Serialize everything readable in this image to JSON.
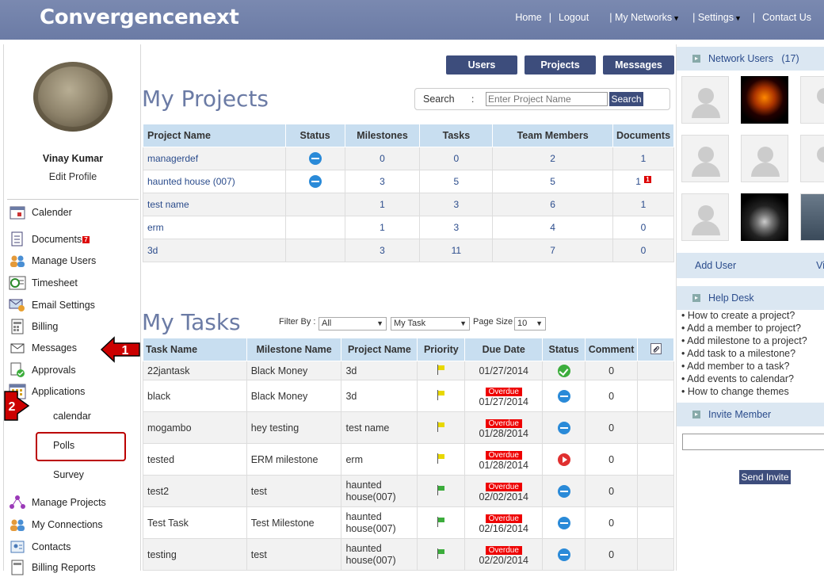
{
  "app": {
    "brand": "Convergencenext"
  },
  "topnav": {
    "home": "Home",
    "logout": "Logout",
    "my_networks": "| My Networks",
    "settings": "| Settings",
    "contact": "Contact Us",
    "sep": "|"
  },
  "profile": {
    "name": "Vinay Kumar",
    "edit": "Edit Profile"
  },
  "sidebar": {
    "calender": "Calender",
    "documents": "Documents",
    "documents_badge": "7",
    "manage_users": "Manage Users",
    "timesheet": "Timesheet",
    "email_settings": "Email Settings",
    "billing": "Billing",
    "messages": "Messages",
    "approvals": "Approvals",
    "applications": "Applications",
    "sub_calendar": "calendar",
    "sub_polls": "Polls",
    "sub_survey": "Survey",
    "manage_projects": "Manage Projects",
    "my_connections": "My Connections",
    "contacts": "Contacts",
    "billing_reports": "Billing Reports",
    "callout1": "1",
    "callout2": "2"
  },
  "tabs": {
    "users": "Users",
    "projects": "Projects",
    "messages": "Messages"
  },
  "projects": {
    "title": "My Projects",
    "search_label": "Search",
    "search_colon": ":",
    "search_placeholder": "Enter Project Name",
    "search_button": "Search",
    "columns": [
      "Project Name",
      "Status",
      "Milestones",
      "Tasks",
      "Team Members",
      "Documents"
    ],
    "rows": [
      {
        "name": "managerdef",
        "milestones": "0",
        "tasks": "0",
        "team": "2",
        "docs": "1",
        "badge": ""
      },
      {
        "name": "haunted house (007)",
        "milestones": "3",
        "tasks": "5",
        "team": "5",
        "docs": "1",
        "badge": "1"
      },
      {
        "name": "test name",
        "milestones": "1",
        "tasks": "3",
        "team": "6",
        "docs": "1",
        "badge": ""
      },
      {
        "name": "erm",
        "milestones": "1",
        "tasks": "3",
        "team": "4",
        "docs": "0",
        "badge": ""
      },
      {
        "name": "3d",
        "milestones": "3",
        "tasks": "11",
        "team": "7",
        "docs": "0",
        "badge": ""
      }
    ]
  },
  "tasks": {
    "title": "My Tasks",
    "filter_label": "Filter By :",
    "filter1": "All",
    "filter2": "My Task",
    "page_size_label": "Page Size :",
    "page_size": "10",
    "columns": [
      "Task Name",
      "Milestone Name",
      "Project Name",
      "Priority",
      "Due Date",
      "Status",
      "Comment"
    ],
    "overdue": "Overdue",
    "rows": [
      {
        "name": "22jantask",
        "milestone": "Black Money",
        "project": "3d",
        "date": "01/27/2014",
        "comment": "0"
      },
      {
        "name": "black",
        "milestone": "Black Money",
        "project": "3d",
        "date": "01/27/2014",
        "comment": "0"
      },
      {
        "name": "mogambo",
        "milestone": "hey testing",
        "project": "test name",
        "date": "01/28/2014",
        "comment": "0"
      },
      {
        "name": "tested",
        "milestone": "ERM milestone",
        "project": "erm",
        "date": "01/28/2014",
        "comment": "0"
      },
      {
        "name": "test2",
        "milestone": "test",
        "project": "haunted house(007)",
        "date": "02/02/2014",
        "comment": "0"
      },
      {
        "name": "Test Task",
        "milestone": "Test Milestone",
        "project": "haunted house(007)",
        "date": "02/16/2014",
        "comment": "0"
      },
      {
        "name": "testing",
        "milestone": "test",
        "project": "haunted house(007)",
        "date": "02/20/2014",
        "comment": "0"
      }
    ]
  },
  "right": {
    "network_users": "Network Users",
    "network_count": "(17)",
    "add_user": "Add User",
    "view": "Vi",
    "help_desk": "Help Desk",
    "help_items": [
      "How to create a project?",
      "Add a member to project?",
      "Add milestone to a project?",
      "Add task to a milestone?",
      "Add member to a task?",
      "Add events to calendar?",
      "How to change themes"
    ],
    "invite_member": "Invite Member",
    "send_invite": "Send Invite"
  },
  "colors": {
    "brand_bar": "#6b7ba5",
    "button": "#3d4d7c",
    "header_bg": "#c8def0",
    "overdue": "#e00000",
    "callout": "#cc0000"
  }
}
